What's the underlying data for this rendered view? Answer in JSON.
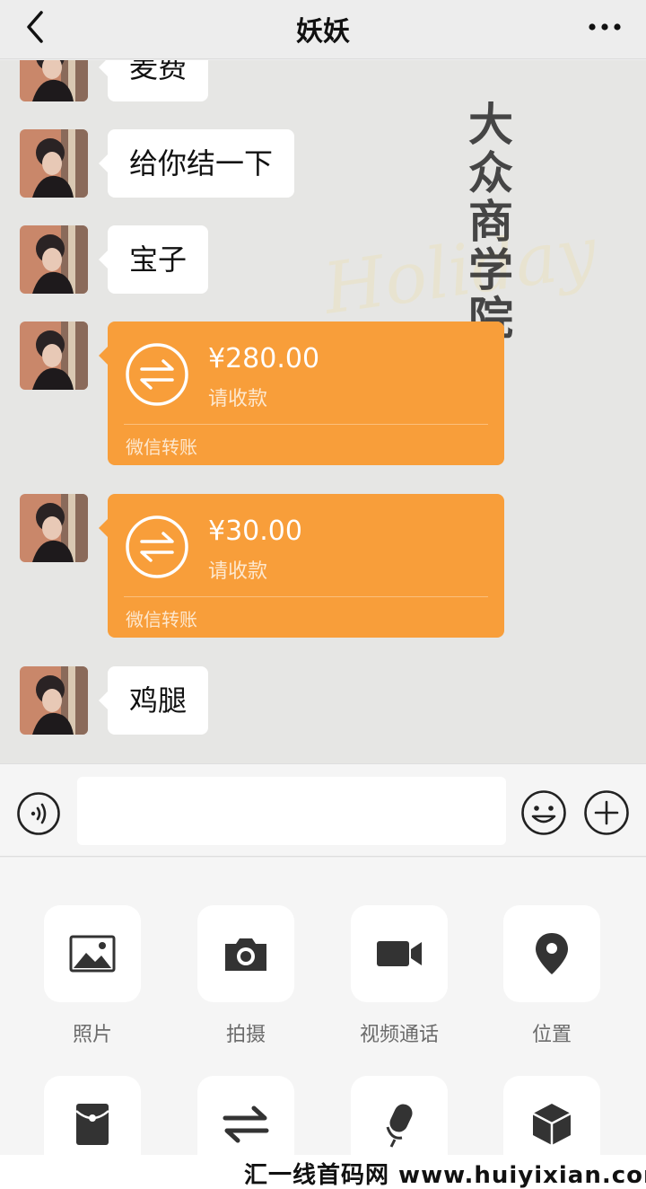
{
  "header": {
    "title": "妖妖",
    "back_icon": "chevron-left-icon",
    "more_icon": "more-dots-icon"
  },
  "chat": {
    "watermark_text": "大众商学院",
    "watermark_script": "Holiday",
    "messages": [
      {
        "type": "text",
        "text": "麦费"
      },
      {
        "type": "text",
        "text": "给你结一下"
      },
      {
        "type": "text",
        "text": "宝子"
      },
      {
        "type": "transfer",
        "amount": "¥280.00",
        "status": "请收款",
        "footer": "微信转账"
      },
      {
        "type": "transfer",
        "amount": "¥30.00",
        "status": "请收款",
        "footer": "微信转账"
      },
      {
        "type": "text",
        "text": "鸡腿"
      }
    ]
  },
  "input_bar": {
    "value": "",
    "placeholder": "",
    "voice_icon": "voice-icon",
    "emoji_icon": "emoji-icon",
    "plus_icon": "plus-circle-icon"
  },
  "tools": {
    "row1": [
      {
        "label": "照片",
        "icon": "photo-icon"
      },
      {
        "label": "拍摄",
        "icon": "camera-icon"
      },
      {
        "label": "视频通话",
        "icon": "video-call-icon"
      },
      {
        "label": "位置",
        "icon": "location-icon"
      }
    ],
    "row2": [
      {
        "label": "",
        "icon": "red-packet-icon"
      },
      {
        "label": "",
        "icon": "transfer-icon"
      },
      {
        "label": "",
        "icon": "microphone-icon"
      },
      {
        "label": "",
        "icon": "box-icon"
      }
    ]
  },
  "site_watermark": "汇一线首码网 www.huiyixian.com",
  "colors": {
    "transfer_orange": "#f89e3a",
    "background": "#ededed",
    "bubble": "#ffffff"
  }
}
